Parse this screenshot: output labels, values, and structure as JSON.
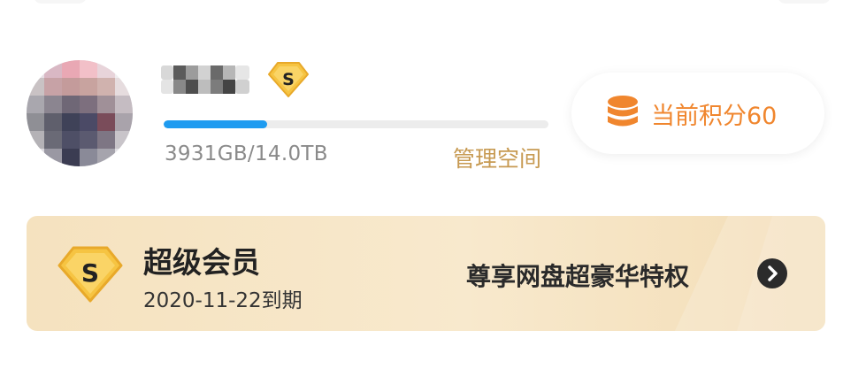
{
  "profile": {
    "storage": {
      "used_fraction": 0.27,
      "text": "3931GB/14.0TB",
      "manage_label": "管理空间",
      "fill_color": "#1e9bf0"
    },
    "badge_icon": "vip-s-badge-icon",
    "points": {
      "label": "当前积分60",
      "icon": "coins-stack-icon",
      "color": "#f0862e"
    }
  },
  "vip": {
    "title": "超级会员",
    "expiry": "2020-11-22到期",
    "privilege": "尊享网盘超豪华特权",
    "arrow_icon": "chevron-right-circle-icon",
    "badge_icon": "vip-s-badge-icon"
  }
}
